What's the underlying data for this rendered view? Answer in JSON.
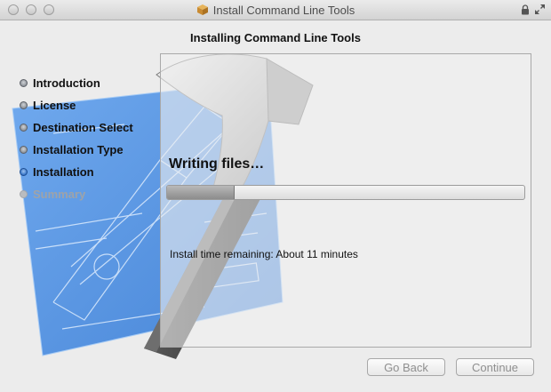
{
  "window": {
    "title": "Install Command Line Tools",
    "icons": {
      "app": "package-icon",
      "lock": "lock-icon",
      "fullscreen": "fullscreen-icon"
    }
  },
  "heading": "Installing Command Line Tools",
  "steps": [
    {
      "label": "Introduction",
      "state": "done"
    },
    {
      "label": "License",
      "state": "done"
    },
    {
      "label": "Destination Select",
      "state": "done"
    },
    {
      "label": "Installation Type",
      "state": "done"
    },
    {
      "label": "Installation",
      "state": "current"
    },
    {
      "label": "Summary",
      "state": "pending"
    }
  ],
  "main": {
    "status": "Writing files…",
    "progress": 0.19,
    "remaining": "Install time remaining: About 11 minutes"
  },
  "buttons": {
    "back": "Go Back",
    "continue": "Continue"
  },
  "colors": {
    "blueprint": "#4f8fe0",
    "hammer_handle": "#3a3a3a",
    "active_step": "#2f6fc4"
  }
}
